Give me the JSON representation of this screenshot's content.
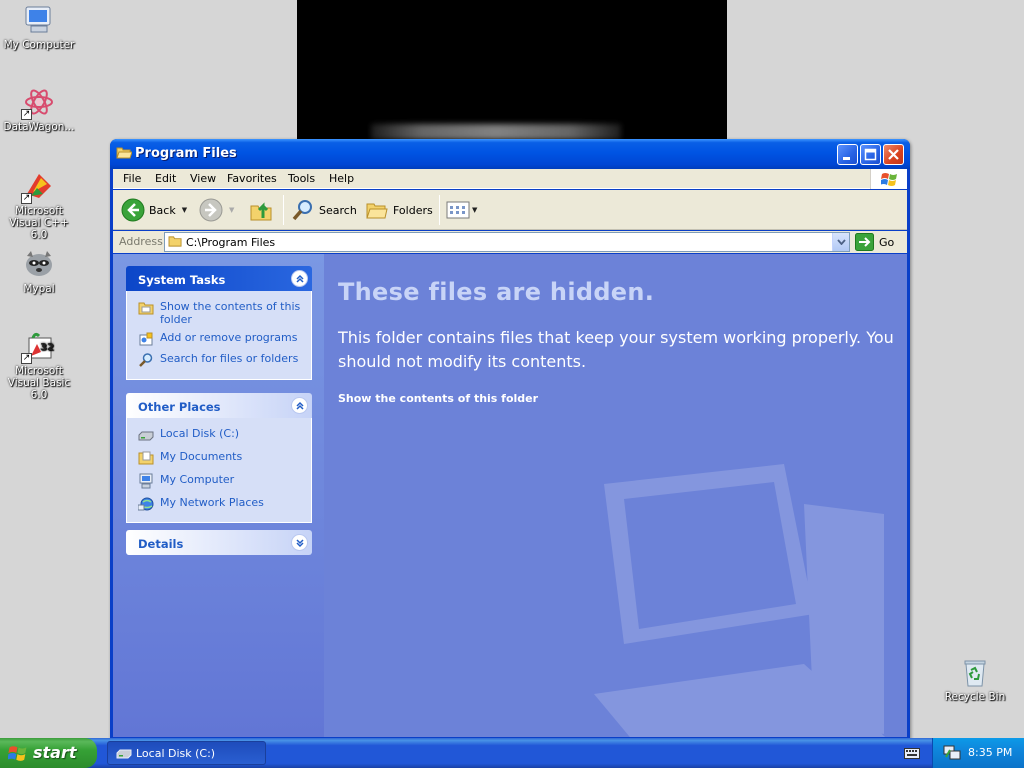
{
  "desktop": {
    "icons": [
      {
        "label": "My Computer"
      },
      {
        "label": "DataWagon..."
      },
      {
        "label": "Microsoft Visual C++ 6.0"
      },
      {
        "label": "Mypal"
      },
      {
        "label": "Microsoft Visual Basic 6.0"
      },
      {
        "label": "Recycle Bin"
      }
    ],
    "vb_badge": "32"
  },
  "window": {
    "title": "Program Files",
    "menu": [
      "File",
      "Edit",
      "View",
      "Favorites",
      "Tools",
      "Help"
    ],
    "toolbar": {
      "back": "Back",
      "search": "Search",
      "folders": "Folders"
    },
    "address": {
      "label": "Address",
      "value": "C:\\Program Files",
      "go": "Go"
    },
    "task_pane": {
      "system_tasks": {
        "title": "System Tasks",
        "items": [
          "Show the contents of this folder",
          "Add or remove programs",
          "Search for files or folders"
        ]
      },
      "other_places": {
        "title": "Other Places",
        "items": [
          "Local Disk (C:)",
          "My Documents",
          "My Computer",
          "My Network Places"
        ]
      },
      "details": {
        "title": "Details"
      }
    },
    "main": {
      "heading": "These files are hidden.",
      "message": "This folder contains files that keep your system working properly. You should not modify its contents.",
      "link": "Show the contents of this folder"
    }
  },
  "taskbar": {
    "start": "start",
    "active_task": "Local Disk (C:)",
    "clock": "8:35 PM"
  },
  "colors": {
    "titlebar": "#0054e3",
    "content_bg": "#6c82d8",
    "link_blue": "#215dc6",
    "taskbar": "#2157d7",
    "start_green": "#36a136"
  }
}
